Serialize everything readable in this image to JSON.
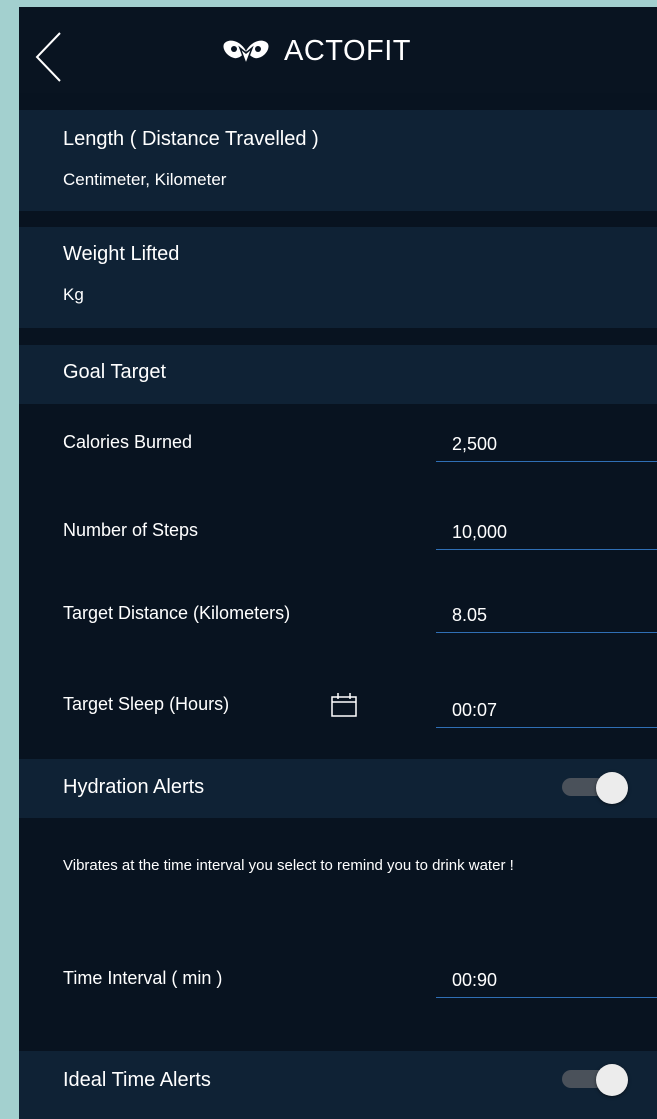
{
  "header": {
    "brand_name": "ACTOFIT",
    "back_icon": "chevron-left-icon",
    "logo_icon": "actofit-logo-icon"
  },
  "units": {
    "length": {
      "title": "Length ( Distance Travelled )",
      "value": "Centimeter, Kilometer"
    },
    "weight": {
      "title": "Weight Lifted",
      "value": "Kg"
    }
  },
  "goal_target": {
    "title": "Goal Target",
    "rows": [
      {
        "label": "Calories Burned",
        "value": "2,500"
      },
      {
        "label": "Number of Steps",
        "value": "10,000"
      },
      {
        "label": "Target Distance (Kilometers)",
        "value": "8.05"
      },
      {
        "label": "Target Sleep (Hours)",
        "value": "00:07",
        "icon": "calendar-icon"
      }
    ]
  },
  "hydration": {
    "title": "Hydration Alerts",
    "enabled": true,
    "description": "Vibrates at the time interval you select to remind you to drink water !",
    "interval_label": "Time Interval ( min )",
    "interval_value": "00:90"
  },
  "ideal_time": {
    "title": "Ideal Time Alerts",
    "enabled": true
  },
  "colors": {
    "background": "#081320",
    "band": "#0f2235",
    "accent_underline": "#2f6fb5",
    "frame": "#a3d0cf"
  }
}
